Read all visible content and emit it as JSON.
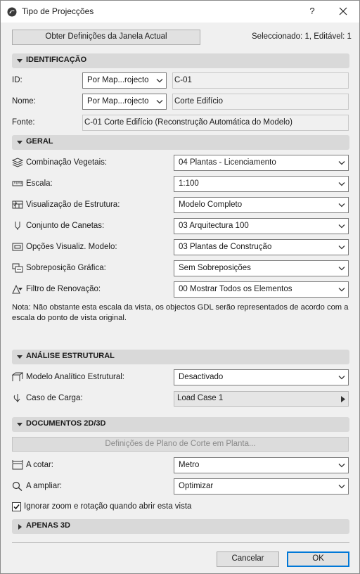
{
  "window": {
    "title": "Tipo de Projecções",
    "help": "?",
    "close_icon": "close-icon",
    "app_icon": "archicad-logo-icon"
  },
  "top": {
    "get_button": "Obter Definições da Janela Actual",
    "selection_status": "Seleccionado: 1, Editável: 1"
  },
  "identificacao": {
    "header": "IDENTIFICAÇÃO",
    "id": {
      "label": "ID:",
      "mode": "Por Map...rojecto",
      "value": "C-01"
    },
    "nome": {
      "label": "Nome:",
      "mode": "Por Map...rojecto",
      "value": "Corte Edifício"
    },
    "fonte": {
      "label": "Fonte:",
      "value": "C-01 Corte Edifício (Reconstrução Automática do Modelo)"
    }
  },
  "geral": {
    "header": "GERAL",
    "rows": [
      {
        "label": "Combinação Vegetais:",
        "value": "04 Plantas - Licenciamento",
        "icon": "layers-icon"
      },
      {
        "label": "Escala:",
        "value": "1:100",
        "icon": "ruler-icon"
      },
      {
        "label": "Visualização de Estrutura:",
        "value": "Modelo Completo",
        "icon": "structure-display-icon"
      },
      {
        "label": "Conjunto de Canetas:",
        "value": "03 Arquitectura 100",
        "icon": "pen-set-icon"
      },
      {
        "label": "Opções Visualiz. Modelo:",
        "value": "03 Plantas de Construção",
        "icon": "model-view-icon"
      },
      {
        "label": "Sobreposição Gráfica:",
        "value": "Sem Sobreposições",
        "icon": "graphic-override-icon"
      },
      {
        "label": "Filtro de Renovação:",
        "value": "00 Mostrar Todos os Elementos",
        "icon": "renovation-filter-icon"
      }
    ],
    "note": "Nota: Não obstante esta escala da vista, os objectos GDL serão representados de acordo com a escala do ponto de vista original."
  },
  "analise": {
    "header": "ANÁLISE ESTRUTURAL",
    "modelo": {
      "label": "Modelo Analítico Estrutural:",
      "value": "Desactivado",
      "icon": "analytical-model-icon"
    },
    "caso": {
      "label": "Caso de Carga:",
      "value": "Load Case 1",
      "icon": "load-case-icon"
    }
  },
  "documentos": {
    "header": "DOCUMENTOS 2D/3D",
    "cut_plane_button": "Definições de Plano de Corte em Planta...",
    "cotar": {
      "label": "A cotar:",
      "value": "Metro",
      "icon": "dimension-icon"
    },
    "ampliar": {
      "label": "A ampliar:",
      "value": "Optimizar",
      "icon": "zoom-icon"
    },
    "ignore_zoom": {
      "label": "Ignorar zoom e rotação quando abrir esta vista",
      "checked": true
    }
  },
  "apenas3d": {
    "header": "APENAS 3D"
  },
  "footer": {
    "cancel": "Cancelar",
    "ok": "OK"
  },
  "colors": {
    "accent": "#0078d7",
    "section": "#d9d9d9",
    "background": "#f0f0f0"
  }
}
